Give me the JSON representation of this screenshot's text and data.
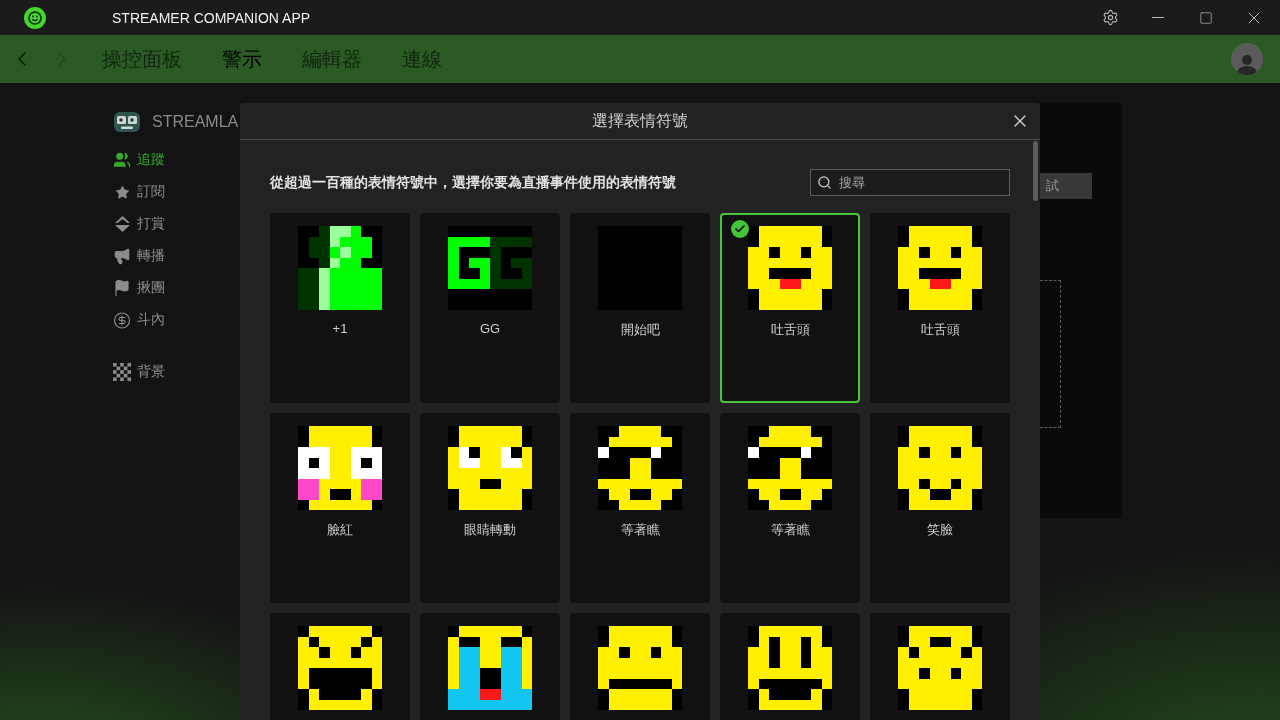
{
  "window": {
    "title": "STREAMER COMPANION APP"
  },
  "nav": {
    "back": {
      "disabled": false
    },
    "forward": {
      "disabled": true
    },
    "tabs": [
      {
        "label": "操控面板",
        "selected": false
      },
      {
        "label": "警示",
        "selected": true
      },
      {
        "label": "編輯器",
        "selected": false
      },
      {
        "label": "連線",
        "selected": false
      }
    ]
  },
  "sidebar": {
    "brand": "STREAMLA",
    "items": [
      {
        "label": "追蹤",
        "selected": true
      },
      {
        "label": "訂閱",
        "selected": false
      },
      {
        "label": "打賞",
        "selected": false
      },
      {
        "label": "轉播",
        "selected": false
      },
      {
        "label": "揪團",
        "selected": false
      },
      {
        "label": "斗內",
        "selected": false
      }
    ],
    "extra_items": [
      {
        "label": "背景",
        "selected": false
      }
    ]
  },
  "alert_panel": {
    "test_button": "試"
  },
  "dialog": {
    "title": "選擇表情符號",
    "description": "從超過一百種的表情符號中，選擇你要為直播事件使用的表情符號",
    "search": {
      "placeholder": "搜尋"
    },
    "emojis": [
      {
        "label": "+1",
        "selected": false
      },
      {
        "label": "GG",
        "selected": false
      },
      {
        "label": "開始吧",
        "selected": false
      },
      {
        "label": "吐舌頭",
        "selected": true
      },
      {
        "label": "吐舌頭",
        "selected": false
      },
      {
        "label": "臉紅",
        "selected": false
      },
      {
        "label": "眼睛轉動",
        "selected": false
      },
      {
        "label": "等著瞧",
        "selected": false
      },
      {
        "label": "等著瞧",
        "selected": false
      },
      {
        "label": "笑臉",
        "selected": false
      },
      {
        "selected": false
      },
      {
        "selected": false
      },
      {
        "selected": false
      },
      {
        "selected": false
      },
      {
        "selected": false
      }
    ]
  }
}
